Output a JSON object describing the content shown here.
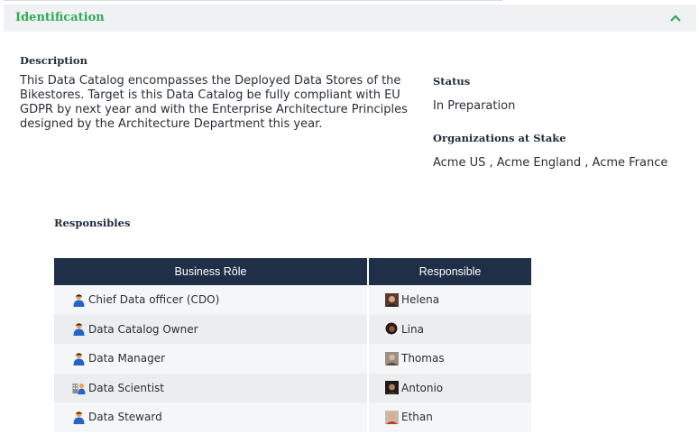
{
  "section": {
    "title": "Identification"
  },
  "description": {
    "label": "Description",
    "lines": [
      "This Data Catalog encompasses the Deployed Data Stores of the",
      "Bikestores. Target is this Data Catalog be fully compliant with EU",
      "GDPR by next year and with the Enterprise Architecture Principles",
      "designed by the Architecture Department this year."
    ]
  },
  "status": {
    "label": "Status",
    "value": "In Preparation"
  },
  "organizations": {
    "label": "Organizations at Stake",
    "value": "Acme US , Acme England , Acme France"
  },
  "responsibles": {
    "label": "Responsibles",
    "headers": {
      "role": "Business Rôle",
      "person": "Responsible"
    },
    "rows": [
      {
        "role": "Chief Data officer (CDO)",
        "person": "Helena",
        "role_icon": "person-icon",
        "avatar": "helena-avatar"
      },
      {
        "role": "Data Catalog Owner",
        "person": "Lina",
        "role_icon": "person-icon",
        "avatar": "lina-avatar"
      },
      {
        "role": "Data Manager",
        "person": "Thomas",
        "role_icon": "person-icon",
        "avatar": "thomas-avatar"
      },
      {
        "role": "Data Scientist",
        "person": "Antonio",
        "role_icon": "organization-person-icon",
        "avatar": "antonio-avatar"
      },
      {
        "role": "Data Steward",
        "person": "Ethan",
        "role_icon": "person-icon",
        "avatar": "ethan-avatar"
      }
    ]
  },
  "colors": {
    "accent": "#2eaa5c",
    "header_bg": "#1f2f48",
    "section_bg": "#f0f1f2"
  }
}
